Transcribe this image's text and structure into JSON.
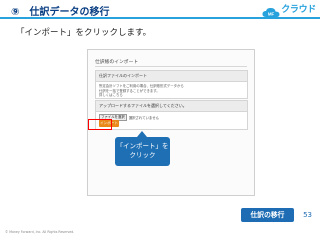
{
  "header": {
    "title": "⑨　仕訳データの移行",
    "logo_text": "クラウド",
    "logo_cloud_text": "MF"
  },
  "instruction": "「インポート」をクリックします。",
  "screenshot": {
    "title": "仕訳帳のインポート",
    "panel1": {
      "heading": "仕訳ファイルのインポート",
      "lines": [
        "所定会計ソフトをご利用の場合、仕訳帳形式データから",
        "仕訳を一括で登録することができます。",
        "詳しくはこちら"
      ]
    },
    "panel2": {
      "heading": "アップロードするファイルを選択してください。",
      "file_button": "ファイルを選択",
      "file_status": "選択されていません"
    },
    "import_button": "インポート"
  },
  "callout": {
    "line1": "「インポート」を",
    "line2": "クリック"
  },
  "section_badge": "仕訳の移行",
  "page_number": "53",
  "copyright": "© Money Forward, Inc. All Rights Reserved.",
  "colors": {
    "accent": "#27a2dc",
    "navy": "#0a3e82",
    "badge": "#1e6db4",
    "import_button": "#e8891a",
    "highlight": "#ff0000"
  },
  "icons": [
    "cloud-icon"
  ]
}
